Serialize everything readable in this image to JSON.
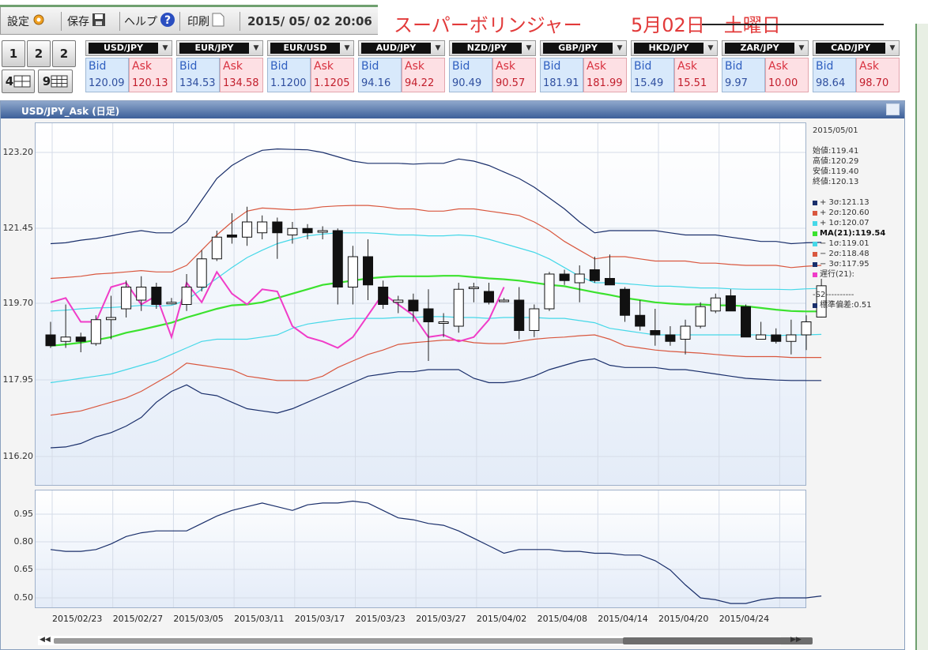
{
  "toolbar": {
    "settings_label": "設定",
    "save_label": "保存",
    "help_label": "ヘルプ",
    "print_label": "印刷",
    "datetime": "2015/ 05/ 02  20:06"
  },
  "overlay": {
    "title": "スーパーボリンジャー",
    "date": "5月02日　土曜日"
  },
  "layout_buttons": [
    "1",
    "2",
    "2",
    "4",
    "9"
  ],
  "currencies": [
    {
      "pair": "USD/JPY",
      "bid_label": "Bid",
      "ask_label": "Ask",
      "bid": "120.09",
      "ask": "120.13"
    },
    {
      "pair": "EUR/JPY",
      "bid_label": "Bid",
      "ask_label": "Ask",
      "bid": "134.53",
      "ask": "134.58"
    },
    {
      "pair": "EUR/USD",
      "bid_label": "Bid",
      "ask_label": "Ask",
      "bid": "1.1200",
      "ask": "1.1205"
    },
    {
      "pair": "AUD/JPY",
      "bid_label": "Bid",
      "ask_label": "Ask",
      "bid": "94.16",
      "ask": "94.22"
    },
    {
      "pair": "NZD/JPY",
      "bid_label": "Bid",
      "ask_label": "Ask",
      "bid": "90.49",
      "ask": "90.57"
    },
    {
      "pair": "GBP/JPY",
      "bid_label": "Bid",
      "ask_label": "Ask",
      "bid": "181.91",
      "ask": "181.99"
    },
    {
      "pair": "HKD/JPY",
      "bid_label": "Bid",
      "ask_label": "Ask",
      "bid": "15.49",
      "ask": "15.51"
    },
    {
      "pair": "ZAR/JPY",
      "bid_label": "Bid",
      "ask_label": "Ask",
      "bid": "9.97",
      "ask": "10.00"
    },
    {
      "pair": "CAD/JPY",
      "bid_label": "Bid",
      "ask_label": "Ask",
      "bid": "98.64",
      "ask": "98.70"
    }
  ],
  "chart": {
    "window_title": "USD/JPY_Ask (日足)",
    "y_ticks": [
      "123.20",
      "121.45",
      "119.70",
      "117.95",
      "116.20"
    ],
    "sub_y_ticks": [
      "0.95",
      "0.80",
      "0.65",
      "0.50"
    ],
    "x_ticks": [
      "2015/02/23",
      "2015/02/27",
      "2015/03/05",
      "2015/03/11",
      "2015/03/17",
      "2015/03/23",
      "2015/03/27",
      "2015/04/02",
      "2015/04/08",
      "2015/04/14",
      "2015/04/20",
      "2015/04/24"
    ]
  },
  "info": {
    "date": "2015/05/01",
    "open": "始値:119.41",
    "high": "高値:120.29",
    "low": "安値:119.40",
    "close": "終値:120.13",
    "legend": [
      {
        "label": "+ 3σ:121.13",
        "color": "#1a2f6b"
      },
      {
        "label": "+ 2σ:120.60",
        "color": "#d9573e"
      },
      {
        "label": "+ 1σ:120.07",
        "color": "#46d8e8"
      },
      {
        "label": "MA(21):119.54",
        "color": "#3be22e"
      },
      {
        "label": "− 1σ:119.01",
        "color": "#46d8e8"
      },
      {
        "label": "− 2σ:118.48",
        "color": "#d9573e"
      },
      {
        "label": "− 3σ:117.95",
        "color": "#1a2f6b"
      },
      {
        "label": "遅行(21):",
        "color": "#f03cc8"
      }
    ],
    "s2_label": "-S2----------",
    "stdev_label": "標準偏差:0.51",
    "stdev_color": "#1a2f6b"
  },
  "chart_data": {
    "type": "line",
    "title": "USD/JPY_Ask (日足)",
    "x": [
      "2015/02/19",
      "2015/02/20",
      "2015/02/23",
      "2015/02/24",
      "2015/02/25",
      "2015/02/26",
      "2015/02/27",
      "2015/03/02",
      "2015/03/03",
      "2015/03/04",
      "2015/03/05",
      "2015/03/06",
      "2015/03/09",
      "2015/03/10",
      "2015/03/11",
      "2015/03/12",
      "2015/03/13",
      "2015/03/16",
      "2015/03/17",
      "2015/03/18",
      "2015/03/19",
      "2015/03/20",
      "2015/03/23",
      "2015/03/24",
      "2015/03/25",
      "2015/03/26",
      "2015/03/27",
      "2015/03/30",
      "2015/03/31",
      "2015/04/01",
      "2015/04/02",
      "2015/04/03",
      "2015/04/06",
      "2015/04/07",
      "2015/04/08",
      "2015/04/09",
      "2015/04/10",
      "2015/04/13",
      "2015/04/14",
      "2015/04/15",
      "2015/04/16",
      "2015/04/17",
      "2015/04/20",
      "2015/04/21",
      "2015/04/22",
      "2015/04/23",
      "2015/04/24",
      "2015/04/27",
      "2015/04/28",
      "2015/04/29",
      "2015/04/30",
      "2015/05/01"
    ],
    "ylim": [
      116.0,
      123.5
    ],
    "candles": [
      {
        "o": 119.0,
        "h": 119.3,
        "l": 118.7,
        "c": 118.75
      },
      {
        "o": 118.85,
        "h": 119.7,
        "l": 118.7,
        "c": 118.95
      },
      {
        "o": 118.95,
        "h": 119.05,
        "l": 118.6,
        "c": 118.85
      },
      {
        "o": 118.8,
        "h": 119.45,
        "l": 118.75,
        "c": 119.35
      },
      {
        "o": 119.35,
        "h": 119.9,
        "l": 118.9,
        "c": 119.4
      },
      {
        "o": 119.6,
        "h": 120.25,
        "l": 119.4,
        "c": 120.1
      },
      {
        "o": 119.8,
        "h": 120.35,
        "l": 119.55,
        "c": 120.1
      },
      {
        "o": 120.1,
        "h": 120.2,
        "l": 119.6,
        "c": 119.7
      },
      {
        "o": 119.75,
        "h": 119.85,
        "l": 119.7,
        "c": 119.75
      },
      {
        "o": 119.7,
        "h": 120.4,
        "l": 119.55,
        "c": 120.1
      },
      {
        "o": 120.1,
        "h": 120.95,
        "l": 120.0,
        "c": 120.75
      },
      {
        "o": 120.75,
        "h": 121.4,
        "l": 120.7,
        "c": 121.25
      },
      {
        "o": 121.3,
        "h": 121.8,
        "l": 121.1,
        "c": 121.25
      },
      {
        "o": 121.25,
        "h": 121.95,
        "l": 121.05,
        "c": 121.6
      },
      {
        "o": 121.35,
        "h": 121.75,
        "l": 121.2,
        "c": 121.6
      },
      {
        "o": 121.6,
        "h": 121.7,
        "l": 120.75,
        "c": 121.35
      },
      {
        "o": 121.3,
        "h": 121.6,
        "l": 121.1,
        "c": 121.45
      },
      {
        "o": 121.45,
        "h": 121.55,
        "l": 121.2,
        "c": 121.35
      },
      {
        "o": 121.4,
        "h": 121.5,
        "l": 121.2,
        "c": 121.4
      },
      {
        "o": 121.4,
        "h": 121.45,
        "l": 119.7,
        "c": 120.1
      },
      {
        "o": 120.1,
        "h": 121.05,
        "l": 119.7,
        "c": 120.8
      },
      {
        "o": 120.8,
        "h": 121.2,
        "l": 119.8,
        "c": 120.15
      },
      {
        "o": 120.1,
        "h": 120.25,
        "l": 119.6,
        "c": 119.7
      },
      {
        "o": 119.75,
        "h": 119.9,
        "l": 119.5,
        "c": 119.8
      },
      {
        "o": 119.8,
        "h": 119.95,
        "l": 119.3,
        "c": 119.55
      },
      {
        "o": 119.6,
        "h": 120.05,
        "l": 118.4,
        "c": 119.3
      },
      {
        "o": 119.3,
        "h": 119.5,
        "l": 118.95,
        "c": 119.3
      },
      {
        "o": 119.2,
        "h": 120.2,
        "l": 119.05,
        "c": 120.05
      },
      {
        "o": 120.1,
        "h": 120.2,
        "l": 119.75,
        "c": 120.1
      },
      {
        "o": 120.0,
        "h": 120.2,
        "l": 119.7,
        "c": 119.75
      },
      {
        "o": 119.8,
        "h": 119.85,
        "l": 119.75,
        "c": 119.8
      },
      {
        "o": 119.8,
        "h": 120.1,
        "l": 118.9,
        "c": 119.1
      },
      {
        "o": 119.1,
        "h": 119.7,
        "l": 118.95,
        "c": 119.6
      },
      {
        "o": 119.6,
        "h": 120.45,
        "l": 119.55,
        "c": 120.4
      },
      {
        "o": 120.4,
        "h": 120.5,
        "l": 120.15,
        "c": 120.25
      },
      {
        "o": 120.2,
        "h": 120.6,
        "l": 119.75,
        "c": 120.4
      },
      {
        "o": 120.5,
        "h": 120.8,
        "l": 120.2,
        "c": 120.25
      },
      {
        "o": 120.3,
        "h": 120.85,
        "l": 120.15,
        "c": 120.15
      },
      {
        "o": 120.05,
        "h": 120.1,
        "l": 119.3,
        "c": 119.45
      },
      {
        "o": 119.45,
        "h": 119.8,
        "l": 119.1,
        "c": 119.2
      },
      {
        "o": 119.1,
        "h": 119.6,
        "l": 118.75,
        "c": 119.0
      },
      {
        "o": 119.0,
        "h": 119.2,
        "l": 118.75,
        "c": 118.85
      },
      {
        "o": 118.9,
        "h": 119.35,
        "l": 118.55,
        "c": 119.2
      },
      {
        "o": 119.2,
        "h": 119.75,
        "l": 119.15,
        "c": 119.65
      },
      {
        "o": 119.55,
        "h": 119.95,
        "l": 119.5,
        "c": 119.85
      },
      {
        "o": 119.9,
        "h": 120.05,
        "l": 119.55,
        "c": 119.55
      },
      {
        "o": 119.65,
        "h": 119.7,
        "l": 118.95,
        "c": 118.95
      },
      {
        "o": 118.9,
        "h": 119.3,
        "l": 118.9,
        "c": 119.0
      },
      {
        "o": 119.0,
        "h": 119.15,
        "l": 118.8,
        "c": 118.85
      },
      {
        "o": 118.85,
        "h": 119.35,
        "l": 118.55,
        "c": 119.0
      },
      {
        "o": 119.0,
        "h": 119.45,
        "l": 118.65,
        "c": 119.3
      },
      {
        "o": 119.41,
        "h": 120.29,
        "l": 119.4,
        "c": 120.13
      }
    ],
    "series": [
      {
        "name": "+ 3σ",
        "color": "#1a2f6b",
        "values": [
          121.1,
          121.12,
          121.18,
          121.22,
          121.28,
          121.35,
          121.4,
          121.35,
          121.35,
          121.6,
          122.1,
          122.6,
          122.9,
          123.1,
          123.25,
          123.28,
          123.27,
          123.26,
          123.2,
          123.1,
          123.0,
          122.95,
          122.95,
          122.95,
          122.93,
          122.95,
          122.95,
          123.05,
          123.0,
          122.9,
          122.75,
          122.6,
          122.4,
          122.15,
          121.9,
          121.6,
          121.35,
          121.4,
          121.4,
          121.4,
          121.4,
          121.35,
          121.3,
          121.3,
          121.3,
          121.25,
          121.2,
          121.15,
          121.15,
          121.1,
          121.12,
          121.13
        ]
      },
      {
        "name": "+ 2σ",
        "color": "#d9573e",
        "values": [
          120.3,
          120.32,
          120.35,
          120.4,
          120.42,
          120.45,
          120.48,
          120.45,
          120.45,
          120.6,
          120.95,
          121.3,
          121.6,
          121.85,
          121.92,
          121.9,
          121.88,
          121.9,
          121.95,
          121.97,
          121.98,
          121.98,
          121.95,
          121.9,
          121.9,
          121.85,
          121.85,
          121.9,
          121.9,
          121.85,
          121.8,
          121.75,
          121.6,
          121.4,
          121.15,
          120.95,
          120.75,
          120.8,
          120.8,
          120.75,
          120.7,
          120.7,
          120.7,
          120.65,
          120.65,
          120.62,
          120.6,
          120.6,
          120.6,
          120.55,
          120.58,
          120.6
        ]
      },
      {
        "name": "+ 1σ",
        "color": "#46d8e8",
        "values": [
          119.55,
          119.57,
          119.6,
          119.62,
          119.63,
          119.65,
          119.68,
          119.66,
          119.68,
          119.8,
          120.05,
          120.3,
          120.55,
          120.78,
          120.95,
          121.1,
          121.2,
          121.28,
          121.32,
          121.35,
          121.35,
          121.35,
          121.33,
          121.3,
          121.3,
          121.28,
          121.28,
          121.3,
          121.28,
          121.2,
          121.1,
          121.0,
          120.9,
          120.75,
          120.55,
          120.35,
          120.2,
          120.2,
          120.18,
          120.15,
          120.12,
          120.12,
          120.1,
          120.08,
          120.08,
          120.06,
          120.05,
          120.05,
          120.05,
          120.04,
          120.06,
          120.07
        ]
      },
      {
        "name": "MA(21)",
        "color": "#3be22e",
        "values": [
          118.75,
          118.78,
          118.82,
          118.88,
          118.95,
          119.05,
          119.12,
          119.2,
          119.28,
          119.4,
          119.5,
          119.6,
          119.68,
          119.7,
          119.75,
          119.85,
          119.95,
          120.05,
          120.15,
          120.2,
          120.25,
          120.3,
          120.33,
          120.35,
          120.35,
          120.35,
          120.36,
          120.36,
          120.33,
          120.3,
          120.28,
          120.25,
          120.2,
          120.15,
          120.12,
          120.05,
          119.98,
          119.92,
          119.85,
          119.8,
          119.75,
          119.72,
          119.7,
          119.7,
          119.68,
          119.68,
          119.66,
          119.62,
          119.58,
          119.55,
          119.54,
          119.54
        ]
      },
      {
        "name": "− 1σ",
        "color": "#46d8e8",
        "values": [
          117.9,
          117.95,
          118.0,
          118.05,
          118.1,
          118.2,
          118.3,
          118.4,
          118.55,
          118.7,
          118.85,
          118.9,
          118.9,
          118.9,
          118.95,
          119.0,
          119.15,
          119.25,
          119.3,
          119.35,
          119.38,
          119.38,
          119.38,
          119.4,
          119.4,
          119.42,
          119.42,
          119.4,
          119.4,
          119.38,
          119.4,
          119.4,
          119.4,
          119.38,
          119.38,
          119.33,
          119.28,
          119.15,
          119.1,
          119.05,
          119.0,
          119.0,
          119.0,
          119.0,
          119.0,
          119.0,
          119.0,
          119.0,
          118.98,
          119.0,
          119.0,
          119.01
        ]
      },
      {
        "name": "− 2σ",
        "color": "#d9573e",
        "values": [
          117.15,
          117.2,
          117.25,
          117.35,
          117.45,
          117.55,
          117.7,
          117.9,
          118.1,
          118.35,
          118.3,
          118.25,
          118.2,
          118.05,
          118.0,
          117.95,
          117.95,
          117.95,
          118.05,
          118.25,
          118.4,
          118.55,
          118.65,
          118.78,
          118.82,
          118.85,
          118.88,
          118.88,
          118.82,
          118.8,
          118.8,
          118.85,
          118.9,
          118.93,
          118.95,
          118.98,
          119.0,
          118.9,
          118.75,
          118.7,
          118.65,
          118.62,
          118.6,
          118.58,
          118.55,
          118.52,
          118.5,
          118.5,
          118.5,
          118.48,
          118.48,
          118.48
        ]
      },
      {
        "name": "− 3σ",
        "color": "#1a2f6b",
        "values": [
          116.4,
          116.42,
          116.5,
          116.65,
          116.75,
          116.9,
          117.1,
          117.45,
          117.7,
          117.85,
          117.65,
          117.6,
          117.45,
          117.3,
          117.25,
          117.2,
          117.3,
          117.45,
          117.6,
          117.75,
          117.9,
          118.05,
          118.1,
          118.15,
          118.15,
          118.2,
          118.2,
          118.2,
          118.0,
          117.9,
          117.9,
          117.95,
          118.05,
          118.2,
          118.3,
          118.4,
          118.45,
          118.3,
          118.25,
          118.25,
          118.25,
          118.2,
          118.2,
          118.15,
          118.1,
          118.05,
          118.0,
          117.98,
          117.96,
          117.95,
          117.95,
          117.95
        ]
      },
      {
        "name": "遅行(21)",
        "color": "#f03cc8",
        "values": [
          119.75,
          119.85,
          119.3,
          119.3,
          120.1,
          120.2,
          119.7,
          119.9,
          118.95,
          120.2,
          119.75,
          120.45,
          119.95,
          119.7,
          120.05,
          120.0,
          119.2,
          118.95,
          118.85,
          118.7,
          118.95,
          119.45,
          119.95,
          119.7,
          119.45,
          118.95,
          119.0,
          118.85,
          118.95,
          119.35,
          120.1
        ]
      }
    ],
    "sub": {
      "ylim": [
        0.45,
        1.05
      ],
      "name": "標準偏差",
      "values": [
        0.76,
        0.75,
        0.75,
        0.76,
        0.79,
        0.83,
        0.85,
        0.86,
        0.86,
        0.86,
        0.9,
        0.94,
        0.97,
        0.99,
        1.01,
        0.99,
        0.97,
        1.0,
        1.01,
        1.01,
        1.02,
        1.01,
        0.97,
        0.93,
        0.92,
        0.9,
        0.89,
        0.86,
        0.82,
        0.78,
        0.74,
        0.76,
        0.76,
        0.76,
        0.75,
        0.75,
        0.74,
        0.74,
        0.73,
        0.73,
        0.7,
        0.65,
        0.57,
        0.5,
        0.49,
        0.47,
        0.47,
        0.49,
        0.5,
        0.5,
        0.5,
        0.51
      ]
    }
  }
}
